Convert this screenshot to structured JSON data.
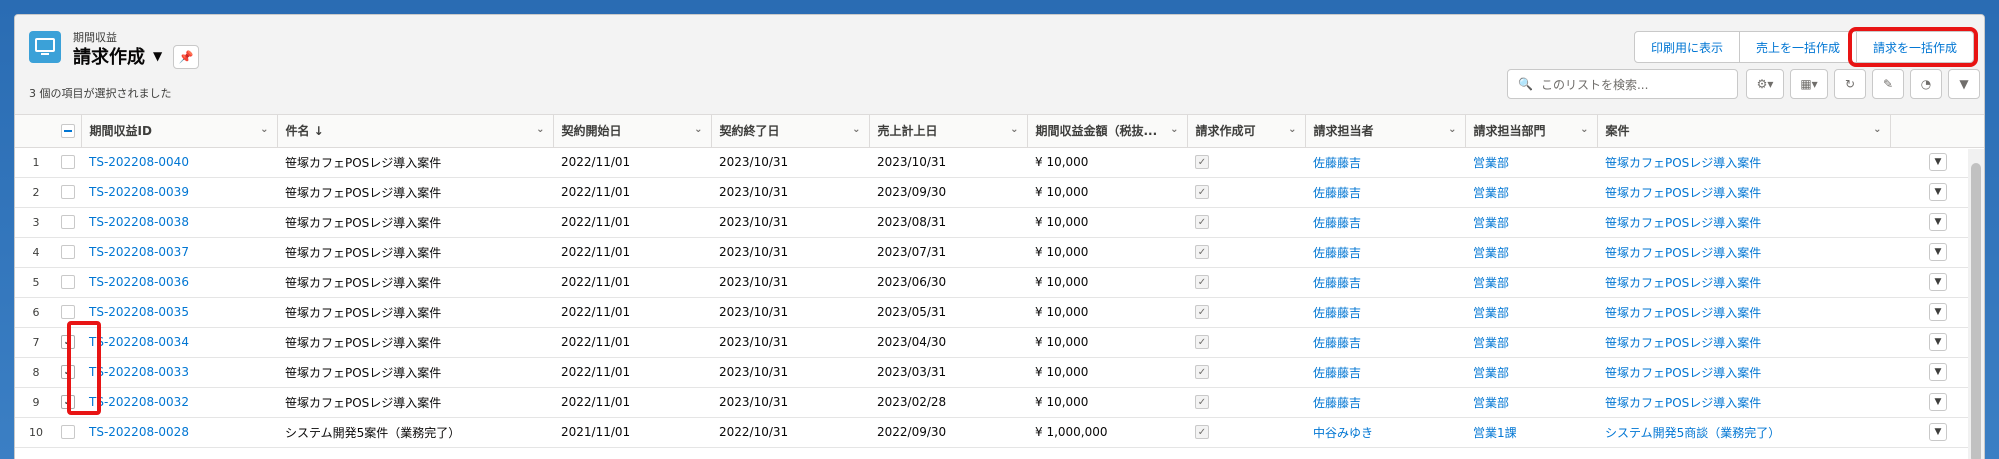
{
  "header": {
    "object_label": "期間収益",
    "list_title": "請求作成",
    "selected_info": "3 個の項目が選択されました",
    "buttons": [
      "印刷用に表示",
      "売上を一括作成",
      "請求を一括作成"
    ],
    "search_placeholder": "このリストを検索..."
  },
  "columns": [
    "期間収益ID",
    "件名 ↓",
    "契約開始日",
    "契約終了日",
    "売上計上日",
    "期間収益金額（税抜...",
    "請求作成可",
    "請求担当者",
    "請求担当部門",
    "案件"
  ],
  "rows": [
    {
      "n": "1",
      "id": "TS-202208-0040",
      "name": "笹塚カフェPOSレジ導入案件",
      "start": "2022/11/01",
      "end": "2023/10/31",
      "sales": "2023/10/31",
      "amount": "¥ 10,000",
      "person": "佐藤藤吉",
      "dept": "営業部",
      "project": "笹塚カフェPOSレジ導入案件",
      "checked": false
    },
    {
      "n": "2",
      "id": "TS-202208-0039",
      "name": "笹塚カフェPOSレジ導入案件",
      "start": "2022/11/01",
      "end": "2023/10/31",
      "sales": "2023/09/30",
      "amount": "¥ 10,000",
      "person": "佐藤藤吉",
      "dept": "営業部",
      "project": "笹塚カフェPOSレジ導入案件",
      "checked": false
    },
    {
      "n": "3",
      "id": "TS-202208-0038",
      "name": "笹塚カフェPOSレジ導入案件",
      "start": "2022/11/01",
      "end": "2023/10/31",
      "sales": "2023/08/31",
      "amount": "¥ 10,000",
      "person": "佐藤藤吉",
      "dept": "営業部",
      "project": "笹塚カフェPOSレジ導入案件",
      "checked": false
    },
    {
      "n": "4",
      "id": "TS-202208-0037",
      "name": "笹塚カフェPOSレジ導入案件",
      "start": "2022/11/01",
      "end": "2023/10/31",
      "sales": "2023/07/31",
      "amount": "¥ 10,000",
      "person": "佐藤藤吉",
      "dept": "営業部",
      "project": "笹塚カフェPOSレジ導入案件",
      "checked": false
    },
    {
      "n": "5",
      "id": "TS-202208-0036",
      "name": "笹塚カフェPOSレジ導入案件",
      "start": "2022/11/01",
      "end": "2023/10/31",
      "sales": "2023/06/30",
      "amount": "¥ 10,000",
      "person": "佐藤藤吉",
      "dept": "営業部",
      "project": "笹塚カフェPOSレジ導入案件",
      "checked": false
    },
    {
      "n": "6",
      "id": "TS-202208-0035",
      "name": "笹塚カフェPOSレジ導入案件",
      "start": "2022/11/01",
      "end": "2023/10/31",
      "sales": "2023/05/31",
      "amount": "¥ 10,000",
      "person": "佐藤藤吉",
      "dept": "営業部",
      "project": "笹塚カフェPOSレジ導入案件",
      "checked": false
    },
    {
      "n": "7",
      "id": "TS-202208-0034",
      "name": "笹塚カフェPOSレジ導入案件",
      "start": "2022/11/01",
      "end": "2023/10/31",
      "sales": "2023/04/30",
      "amount": "¥ 10,000",
      "person": "佐藤藤吉",
      "dept": "営業部",
      "project": "笹塚カフェPOSレジ導入案件",
      "checked": true
    },
    {
      "n": "8",
      "id": "TS-202208-0033",
      "name": "笹塚カフェPOSレジ導入案件",
      "start": "2022/11/01",
      "end": "2023/10/31",
      "sales": "2023/03/31",
      "amount": "¥ 10,000",
      "person": "佐藤藤吉",
      "dept": "営業部",
      "project": "笹塚カフェPOSレジ導入案件",
      "checked": true
    },
    {
      "n": "9",
      "id": "TS-202208-0032",
      "name": "笹塚カフェPOSレジ導入案件",
      "start": "2022/11/01",
      "end": "2023/10/31",
      "sales": "2023/02/28",
      "amount": "¥ 10,000",
      "person": "佐藤藤吉",
      "dept": "営業部",
      "project": "笹塚カフェPOSレジ導入案件",
      "checked": true
    },
    {
      "n": "10",
      "id": "TS-202208-0028",
      "name": "システム開発5案件（業務完了）",
      "start": "2021/11/01",
      "end": "2022/10/31",
      "sales": "2022/09/30",
      "amount": "¥ 1,000,000",
      "person": "中谷みゆき",
      "dept": "営業1課",
      "project": "システム開発5商談（業務完了）",
      "checked": false
    }
  ]
}
